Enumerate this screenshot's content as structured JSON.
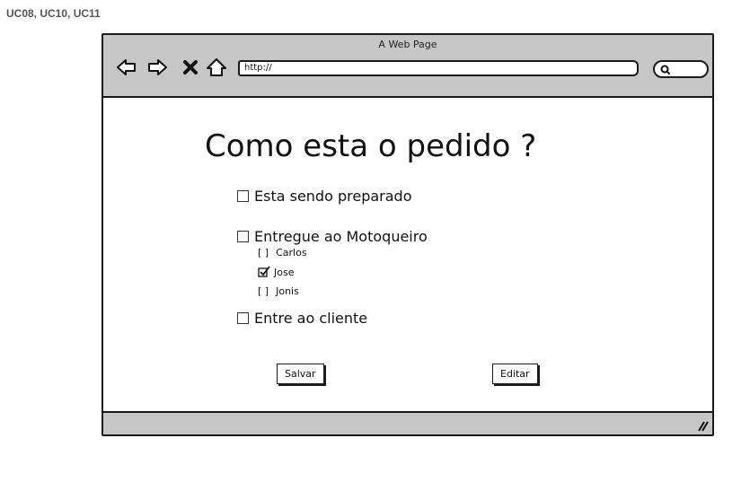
{
  "document": {
    "title": "UC08, UC10, UC11"
  },
  "browser": {
    "page_title": "A Web Page",
    "url": "http://",
    "nav_icons": [
      "back-arrow-icon",
      "forward-arrow-icon",
      "stop-icon",
      "home-icon"
    ]
  },
  "main": {
    "heading": "Como esta o pedido ?",
    "options": {
      "preparing": "Esta sendo preparado",
      "delivered": "Entregue ao Motoqueiro",
      "delivered_client": "Entre ao cliente"
    },
    "couriers": [
      {
        "name": "Carlos",
        "checked": false
      },
      {
        "name": "Jose",
        "checked": true
      },
      {
        "name": "Jonis",
        "checked": false
      }
    ],
    "unchecked_marker": "[ ]",
    "buttons": {
      "save": "Salvar",
      "edit": "Editar"
    }
  }
}
